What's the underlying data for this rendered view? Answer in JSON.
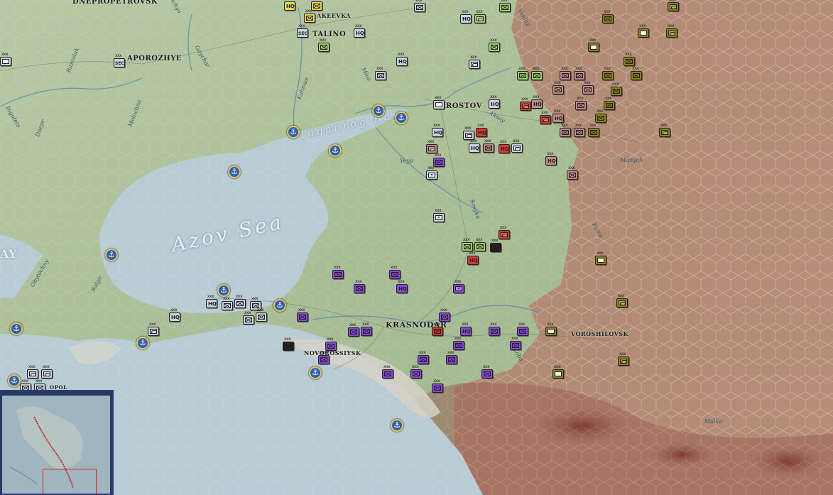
{
  "map": {
    "sea_label": "Azov Sea",
    "gulf_label": "Taganrog Bay",
    "cities": [
      {
        "key": "dnepro",
        "label": "DNEPROPETROVSK"
      },
      {
        "key": "makeevka",
        "label": "AKEEVKA"
      },
      {
        "key": "stalino",
        "label": "TALINO"
      },
      {
        "key": "zaporozhye",
        "label": "APOROZHYE"
      },
      {
        "key": "rostov",
        "label": "ROSTOV"
      },
      {
        "key": "krasnodar",
        "label": "KRASNODAR"
      },
      {
        "key": "novorossiysk",
        "label": "NOVOROSSIYSK"
      },
      {
        "key": "voroshilovsk",
        "label": "VOROSHILOVSK"
      },
      {
        "key": "left_edge",
        "label": "AY"
      },
      {
        "key": "bottom_left",
        "label": "OPOL"
      }
    ],
    "rivers": [
      {
        "key": "manych",
        "label": "Manych"
      },
      {
        "key": "yeya",
        "label": "Yeya"
      },
      {
        "key": "sosyka",
        "label": "Sosyka"
      },
      {
        "key": "kalmius",
        "label": "Kalmius"
      },
      {
        "key": "mius",
        "label": "Mius"
      },
      {
        "key": "aksay",
        "label": "Aksay"
      },
      {
        "key": "malka",
        "label": "Malka"
      },
      {
        "key": "ingulets",
        "label": "Ingulets"
      },
      {
        "key": "dnepr",
        "label": "Dnepr"
      },
      {
        "key": "molochna",
        "label": "Molochna"
      },
      {
        "key": "obytochnaya",
        "label": "Obytochny"
      },
      {
        "key": "salgir",
        "label": "Salgir"
      },
      {
        "key": "basavluk",
        "label": "Bazavluk"
      },
      {
        "key": "volchya",
        "label": "Volchya"
      },
      {
        "key": "gaychur",
        "label": "Gaychur"
      },
      {
        "key": "veklay",
        "label": "Veklay"
      },
      {
        "key": "kuma",
        "label": "Kuma"
      },
      {
        "key": "laba",
        "label": "Laba"
      }
    ]
  },
  "colors": {
    "axis_german": "#c9d1dc",
    "axis_italian": "#9fd06c",
    "soviet_red": "#d23b32",
    "soviet_pink": "#c08a8a",
    "soviet_purple": "#8a47d8",
    "soviet_olive": "#8d8316",
    "sea": "#b8ccd6",
    "land": "#a8bc95",
    "enemy_hex_zone": "#b89077"
  },
  "ports_icon": "anchor-icon",
  "minimap": {
    "label": "minimap"
  }
}
